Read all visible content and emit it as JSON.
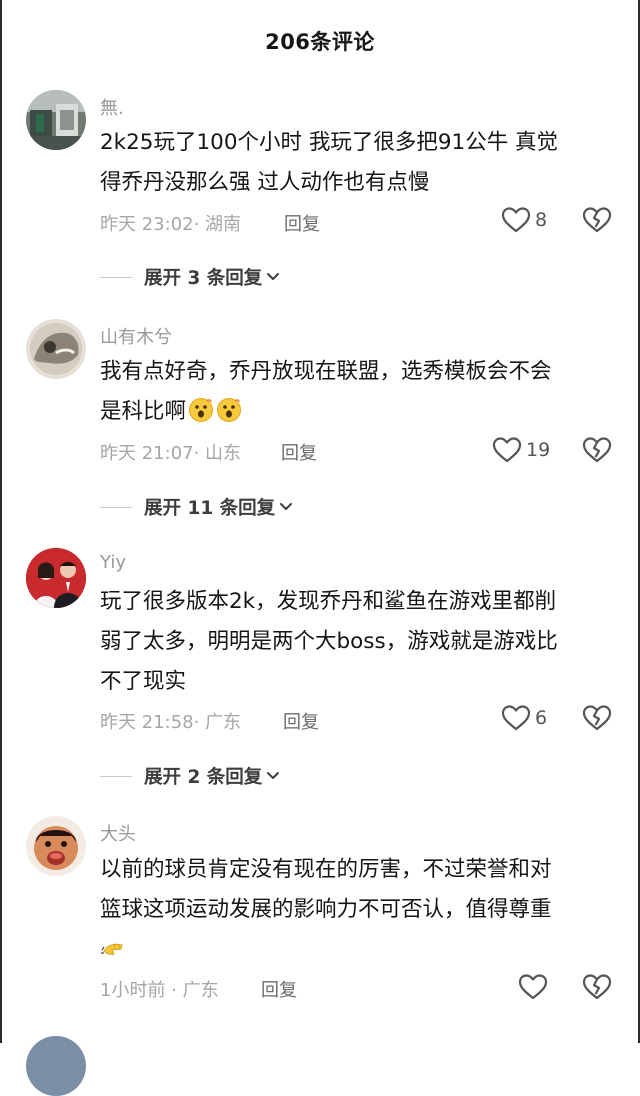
{
  "header": {
    "title": "206条评论"
  },
  "comments": [
    {
      "username": "無.",
      "text_line1": "2k25玩了100个小时 我玩了很多把91公牛 真觉",
      "text_line2": "得乔丹没那么强 过人动作也有点慢",
      "time": "昨天 23:02· 湖南",
      "reply": "回复",
      "likes": "8",
      "expand": "展开 3 条回复"
    },
    {
      "username": "山有木兮",
      "text_line1": "我有点好奇，乔丹放现在联盟，选秀模板会不会",
      "text_line2": "是科比啊",
      "time": "昨天 21:07· 山东",
      "reply": "回复",
      "likes": "19",
      "expand": "展开 11 条回复"
    },
    {
      "username": "Yiy",
      "text_line1": "玩了很多版本2k，发现乔丹和鲨鱼在游戏里都削",
      "text_line2": "弱了太多，明明是两个大boss，游戏就是游戏比",
      "text_line3": "不了现实",
      "time": "昨天 21:58· 广东",
      "reply": "回复",
      "likes": "6",
      "expand": "展开 2 条回复"
    },
    {
      "username": "大头",
      "text_line1": "以前的球员肯定没有现在的厉害，不过荣誉和对",
      "text_line2": "篮球这项运动发展的影响力不可否认，值得尊重",
      "time": "1小时前 · 广东",
      "reply": "回复"
    }
  ],
  "icons": {
    "like": "heart-outline-icon",
    "dislike": "broken-heart-icon",
    "expand": "chevron-down-icon"
  },
  "colors": {
    "username": "#9a9a9a",
    "meta": "#a6a6a6",
    "text": "#161616"
  }
}
